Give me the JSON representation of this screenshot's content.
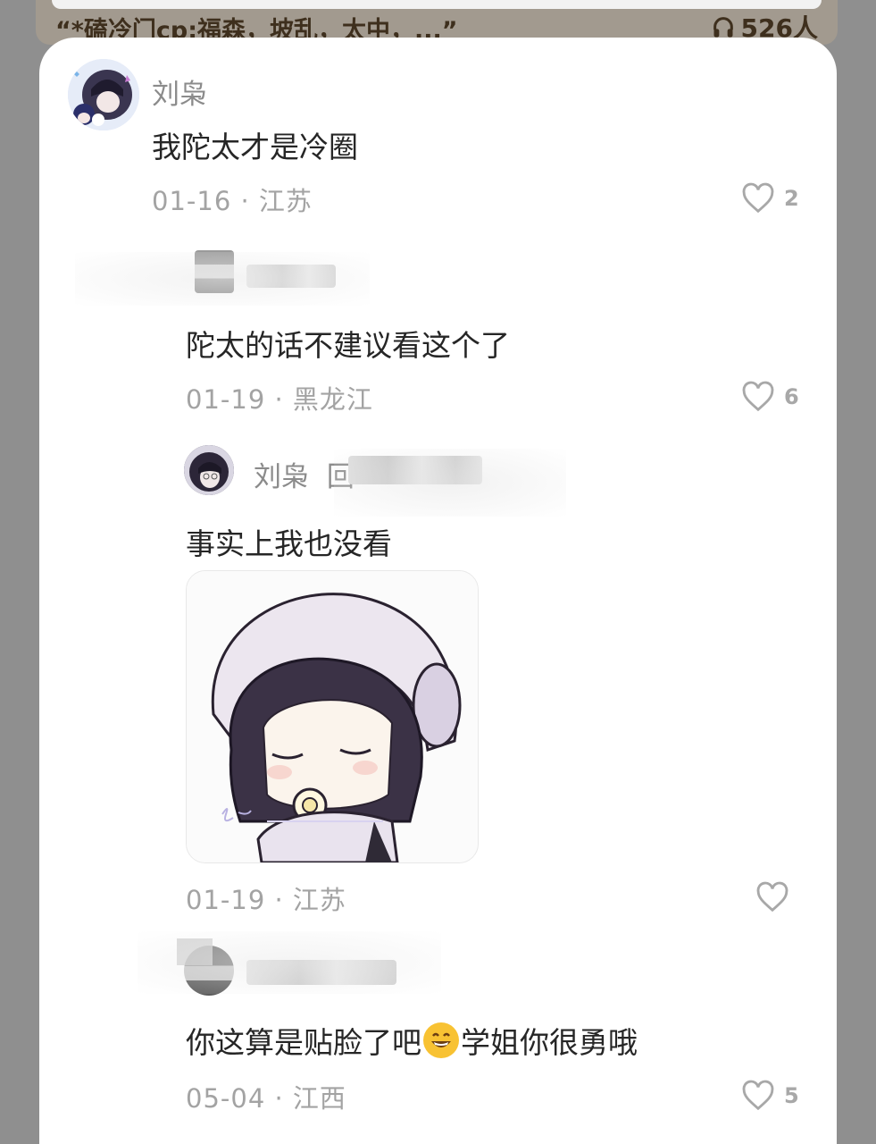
{
  "topbar": {
    "title": "“*磕冷门cp:福森，坡乱，太中，...”",
    "listeners": "526人"
  },
  "comments": [
    {
      "username": "刘枭",
      "content": "我陀太才是冷圈",
      "meta": "01-16 · 江苏",
      "likes": "2"
    },
    {
      "username": "",
      "content": "陀太的话不建议看这个了",
      "meta": "01-19 · 黑龙江",
      "likes": "6"
    },
    {
      "username": "刘枭",
      "reply_prefix": "回",
      "content": "事实上我也没看",
      "meta": "01-19 · 江苏",
      "likes": ""
    },
    {
      "username": "",
      "content_before": "你这算是贴脸了吧",
      "emoji": "grinning-face-emoji",
      "content_after": "学姐你很勇哦",
      "meta": "05-04 · 江西",
      "likes": "5"
    }
  ],
  "colors": {
    "backdrop": "#8f8f8f",
    "topbar": "#a29a8f",
    "username": "#8b8b8b",
    "content": "#262626",
    "meta": "#a3a3a3"
  }
}
